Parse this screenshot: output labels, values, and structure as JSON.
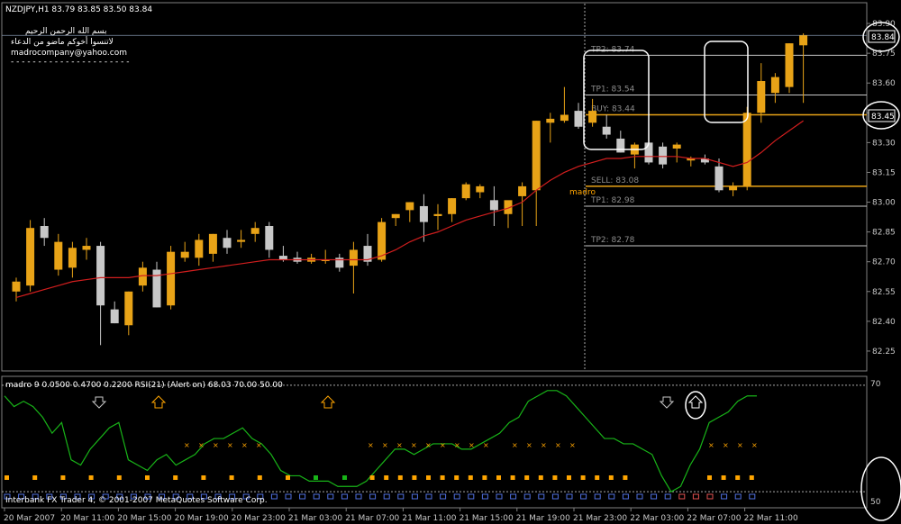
{
  "header": {
    "symbol": "NZDJPY,H1  83.79 83.85 83.50 83.84",
    "arabic_line1": "بسم الله الرحمن الرحيم",
    "arabic_line2": "لاتنسوا أخوكم ماضو من الدعاء",
    "email": "madrocompany@yahoo.com",
    "dashes": "- - - - - - - - - - - - - - - - - - - - - -"
  },
  "price_box": {
    "current": "83.84",
    "level": "83.45"
  },
  "indicator": {
    "title": "madro 9  0.0500  0.4700  0.2200  RSI(21) (Alert on)  68.03  70.00  50.00",
    "axis_top": "70",
    "axis_bottom": "50"
  },
  "footer": {
    "copyright": "Interbank FX Trader 4, © 2001-2007 MetaQuotes Software Corp."
  },
  "colors": {
    "bull": "#e8a317",
    "bear": "#c8c8c8",
    "ma": "#d21e1e",
    "rsi": "#18b418",
    "signal": "#ffa500",
    "level_line": "#c8c8c8",
    "entry_line": "#e8a317"
  },
  "chart_data": {
    "type": "candlestick",
    "ylim": [
      82.15,
      84.0
    ],
    "yticks": [
      "83.90",
      "83.75",
      "83.60",
      "83.45",
      "83.30",
      "83.15",
      "83.00",
      "82.85",
      "82.70",
      "82.55",
      "82.40",
      "82.25"
    ],
    "xticks": [
      "20 Mar 2007",
      "20 Mar 11:00",
      "20 Mar 15:00",
      "20 Mar 19:00",
      "20 Mar 23:00",
      "21 Mar 03:00",
      "21 Mar 07:00",
      "21 Mar 11:00",
      "21 Mar 15:00",
      "21 Mar 19:00",
      "21 Mar 23:00",
      "22 Mar 03:00",
      "22 Mar 07:00",
      "22 Mar 11:00"
    ],
    "candles": [
      {
        "o": 82.55,
        "h": 82.62,
        "l": 82.5,
        "c": 82.6
      },
      {
        "o": 82.58,
        "h": 82.91,
        "l": 82.55,
        "c": 82.87
      },
      {
        "o": 82.88,
        "h": 82.92,
        "l": 82.78,
        "c": 82.82
      },
      {
        "o": 82.66,
        "h": 82.84,
        "l": 82.63,
        "c": 82.8
      },
      {
        "o": 82.67,
        "h": 82.8,
        "l": 82.62,
        "c": 82.77
      },
      {
        "o": 82.76,
        "h": 82.82,
        "l": 82.71,
        "c": 82.78
      },
      {
        "o": 82.78,
        "h": 82.8,
        "l": 82.28,
        "c": 82.48
      },
      {
        "o": 82.46,
        "h": 82.5,
        "l": 82.39,
        "c": 82.39
      },
      {
        "o": 82.38,
        "h": 82.55,
        "l": 82.33,
        "c": 82.55
      },
      {
        "o": 82.58,
        "h": 82.7,
        "l": 82.55,
        "c": 82.67
      },
      {
        "o": 82.66,
        "h": 82.7,
        "l": 82.47,
        "c": 82.47
      },
      {
        "o": 82.48,
        "h": 82.78,
        "l": 82.46,
        "c": 82.75
      },
      {
        "o": 82.72,
        "h": 82.8,
        "l": 82.7,
        "c": 82.75
      },
      {
        "o": 82.72,
        "h": 82.84,
        "l": 82.68,
        "c": 82.81
      },
      {
        "o": 82.74,
        "h": 82.84,
        "l": 82.7,
        "c": 82.84
      },
      {
        "o": 82.82,
        "h": 82.86,
        "l": 82.74,
        "c": 82.77
      },
      {
        "o": 82.8,
        "h": 82.86,
        "l": 82.77,
        "c": 82.81
      },
      {
        "o": 82.84,
        "h": 82.9,
        "l": 82.8,
        "c": 82.87
      },
      {
        "o": 82.88,
        "h": 82.9,
        "l": 82.72,
        "c": 82.76
      },
      {
        "o": 82.73,
        "h": 82.78,
        "l": 82.7,
        "c": 82.71
      },
      {
        "o": 82.72,
        "h": 82.75,
        "l": 82.69,
        "c": 82.7
      },
      {
        "o": 82.7,
        "h": 82.74,
        "l": 82.69,
        "c": 82.72
      },
      {
        "o": 82.71,
        "h": 82.76,
        "l": 82.69,
        "c": 82.71
      },
      {
        "o": 82.72,
        "h": 82.74,
        "l": 82.65,
        "c": 82.67
      },
      {
        "o": 82.68,
        "h": 82.8,
        "l": 82.54,
        "c": 82.76
      },
      {
        "o": 82.78,
        "h": 82.84,
        "l": 82.68,
        "c": 82.7
      },
      {
        "o": 82.71,
        "h": 82.92,
        "l": 82.7,
        "c": 82.9
      },
      {
        "o": 82.92,
        "h": 82.94,
        "l": 82.88,
        "c": 82.94
      },
      {
        "o": 82.96,
        "h": 83.0,
        "l": 82.9,
        "c": 83.0
      },
      {
        "o": 82.98,
        "h": 83.04,
        "l": 82.8,
        "c": 82.9
      },
      {
        "o": 82.93,
        "h": 82.99,
        "l": 82.86,
        "c": 82.94
      },
      {
        "o": 82.94,
        "h": 83.02,
        "l": 82.9,
        "c": 83.02
      },
      {
        "o": 83.02,
        "h": 83.1,
        "l": 83.01,
        "c": 83.09
      },
      {
        "o": 83.05,
        "h": 83.09,
        "l": 83.02,
        "c": 83.08
      },
      {
        "o": 83.01,
        "h": 83.08,
        "l": 82.88,
        "c": 82.96
      },
      {
        "o": 82.94,
        "h": 82.98,
        "l": 82.87,
        "c": 83.01
      },
      {
        "o": 83.03,
        "h": 83.1,
        "l": 82.88,
        "c": 83.08
      },
      {
        "o": 83.06,
        "h": 83.41,
        "l": 82.88,
        "c": 83.41
      },
      {
        "o": 83.4,
        "h": 83.45,
        "l": 83.3,
        "c": 83.42
      },
      {
        "o": 83.41,
        "h": 83.58,
        "l": 83.4,
        "c": 83.44
      },
      {
        "o": 83.46,
        "h": 83.5,
        "l": 83.37,
        "c": 83.38
      },
      {
        "o": 83.4,
        "h": 83.52,
        "l": 83.38,
        "c": 83.46
      },
      {
        "o": 83.38,
        "h": 83.44,
        "l": 83.32,
        "c": 83.34
      },
      {
        "o": 83.32,
        "h": 83.36,
        "l": 83.25,
        "c": 83.25
      },
      {
        "o": 83.24,
        "h": 83.3,
        "l": 83.17,
        "c": 83.29
      },
      {
        "o": 83.3,
        "h": 83.36,
        "l": 83.19,
        "c": 83.2
      },
      {
        "o": 83.28,
        "h": 83.3,
        "l": 83.17,
        "c": 83.19
      },
      {
        "o": 83.27,
        "h": 83.3,
        "l": 83.2,
        "c": 83.29
      },
      {
        "o": 83.21,
        "h": 83.23,
        "l": 83.18,
        "c": 83.22
      },
      {
        "o": 83.22,
        "h": 83.24,
        "l": 83.19,
        "c": 83.2
      },
      {
        "o": 83.18,
        "h": 83.22,
        "l": 83.05,
        "c": 83.06
      },
      {
        "o": 83.06,
        "h": 83.1,
        "l": 83.03,
        "c": 83.08
      },
      {
        "o": 83.08,
        "h": 83.48,
        "l": 83.06,
        "c": 83.45
      },
      {
        "o": 83.45,
        "h": 83.7,
        "l": 83.4,
        "c": 83.61
      },
      {
        "o": 83.55,
        "h": 83.65,
        "l": 83.5,
        "c": 83.63
      },
      {
        "o": 83.58,
        "h": 83.8,
        "l": 83.55,
        "c": 83.8
      },
      {
        "o": 83.79,
        "h": 83.85,
        "l": 83.5,
        "c": 83.84
      }
    ],
    "ma": [
      82.52,
      82.54,
      82.56,
      82.58,
      82.6,
      82.61,
      82.62,
      82.62,
      82.62,
      82.63,
      82.63,
      82.64,
      82.65,
      82.66,
      82.67,
      82.68,
      82.69,
      82.7,
      82.71,
      82.71,
      82.71,
      82.71,
      82.71,
      82.71,
      82.71,
      82.71,
      82.73,
      82.76,
      82.8,
      82.83,
      82.85,
      82.88,
      82.91,
      82.93,
      82.95,
      82.97,
      83.0,
      83.06,
      83.11,
      83.15,
      83.18,
      83.2,
      83.22,
      83.22,
      83.23,
      83.23,
      83.23,
      83.23,
      83.22,
      83.22,
      83.2,
      83.18,
      83.2,
      83.25,
      83.31,
      83.36,
      83.41
    ],
    "levels": [
      {
        "label": "TP2: 83.74",
        "value": 83.74,
        "kind": "level"
      },
      {
        "label": "TP1: 83.54",
        "value": 83.54,
        "kind": "level"
      },
      {
        "label": "BUY: 83.44",
        "value": 83.44,
        "kind": "entry"
      },
      {
        "label": "SELL: 83.08",
        "value": 83.08,
        "kind": "entry"
      },
      {
        "label": "TP1: 82.98",
        "value": 82.98,
        "kind": "level"
      },
      {
        "label": "TP2: 82.78",
        "value": 82.78,
        "kind": "level"
      }
    ],
    "annotation": "madro",
    "rsi": {
      "ylim": [
        48,
        71
      ],
      "values": [
        68,
        66,
        67,
        66,
        64,
        61,
        63,
        56,
        55,
        58,
        60,
        62,
        63,
        56,
        55,
        54,
        56,
        57,
        55,
        56,
        57,
        59,
        60,
        60,
        61,
        62,
        60,
        59,
        57,
        54,
        53,
        53,
        52,
        52,
        52,
        51,
        51,
        51,
        52,
        54,
        56,
        58,
        58,
        57,
        58,
        59,
        59,
        59,
        58,
        58,
        59,
        60,
        61,
        63,
        64,
        67,
        68,
        69,
        69,
        68,
        66,
        64,
        62,
        60,
        60,
        59,
        59,
        58,
        57,
        53,
        50,
        51,
        55,
        58,
        63,
        64,
        65,
        67,
        68,
        68
      ],
      "arrows_down": [
        6,
        43
      ],
      "arrows_up": [
        9,
        20,
        45
      ]
    }
  }
}
